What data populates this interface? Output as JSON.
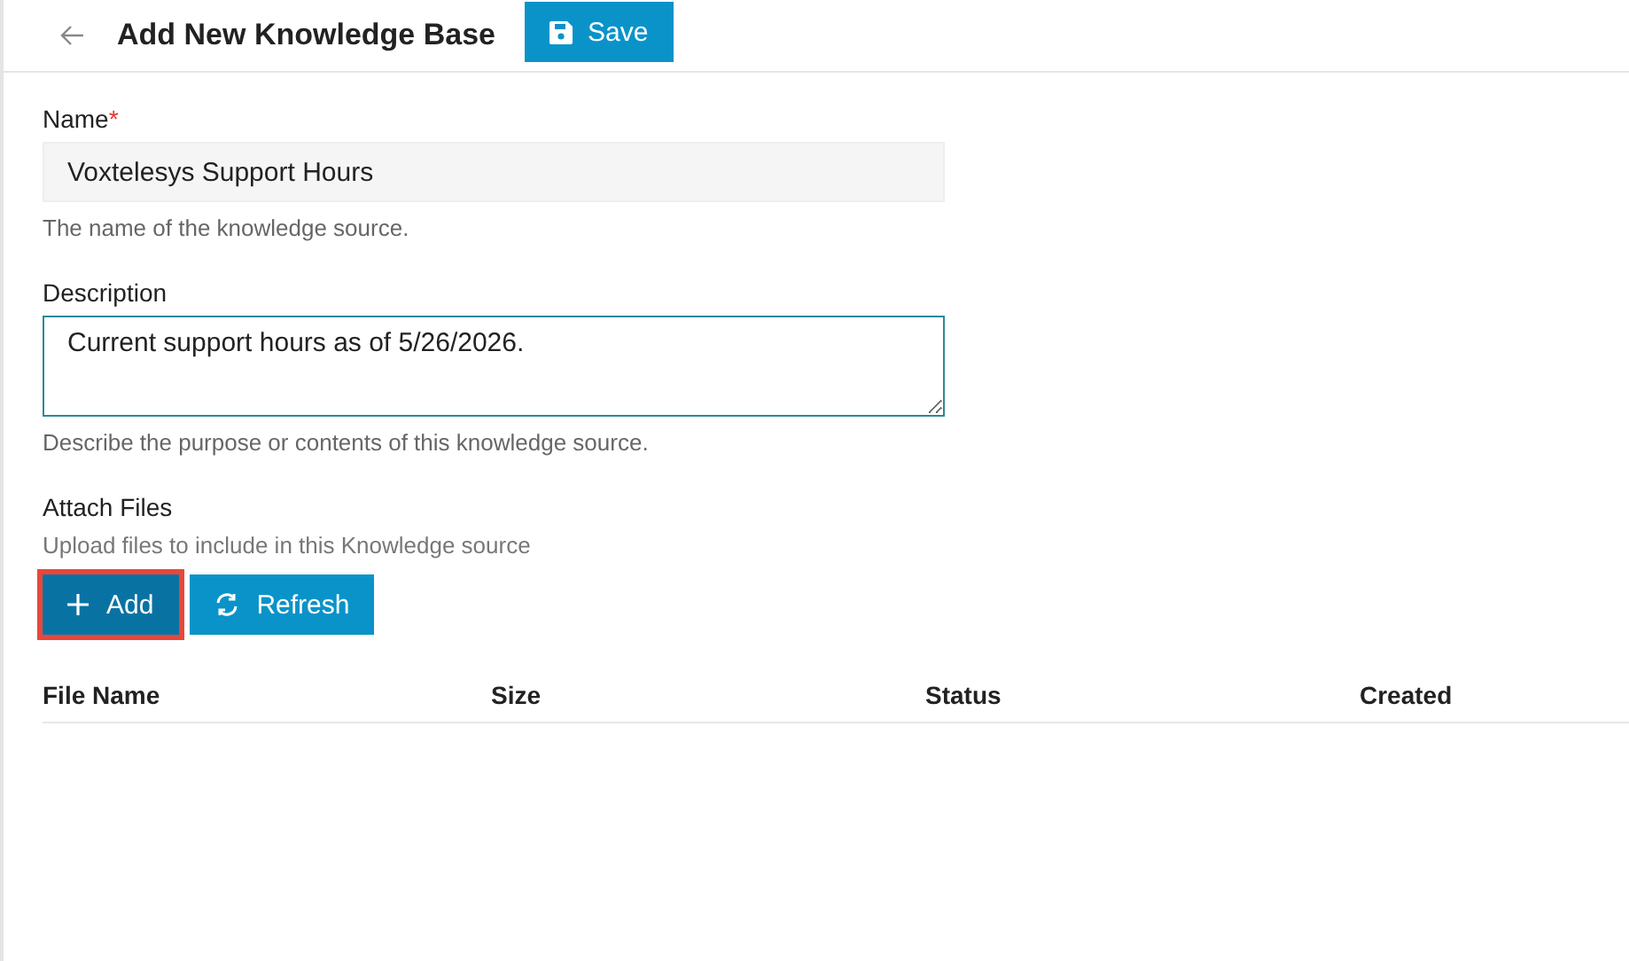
{
  "header": {
    "title": "Add New Knowledge Base",
    "save_button": "Save"
  },
  "fields": [
    {
      "kind": "input",
      "label": "Name",
      "required_mark": "*",
      "value": "Voxtelesys Support Hours",
      "focused": false,
      "help": "The name of the knowledge source."
    },
    {
      "kind": "textarea",
      "label": "Description",
      "value": "Current support hours as of 5/26/2026.",
      "focused": true,
      "help": "Describe the purpose or contents of this knowledge source."
    }
  ],
  "attach": {
    "label": "Attach Files",
    "help": "Upload files to include in this Knowledge source",
    "buttons": [
      {
        "kind": "add",
        "label": "Add",
        "highlighted": true
      },
      {
        "kind": "refresh",
        "label": "Refresh",
        "highlighted": false
      }
    ]
  },
  "table": {
    "columns": [
      "File Name",
      "Size",
      "Status",
      "Created"
    ]
  }
}
